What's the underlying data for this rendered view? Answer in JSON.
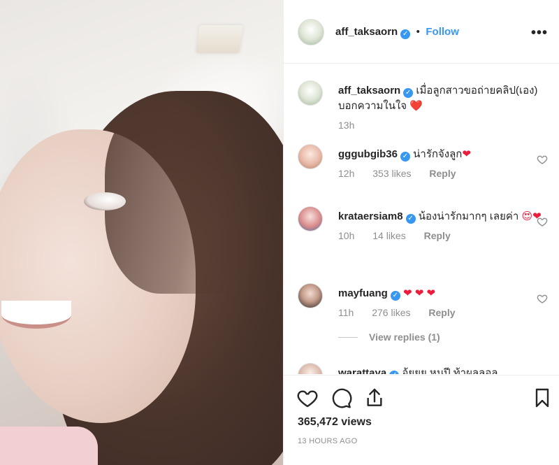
{
  "post_author": {
    "username": "aff_taksaorn",
    "follow_label": "Follow",
    "separator": "•"
  },
  "caption": {
    "username": "aff_taksaorn",
    "text": "เมื่อลูกสาวขอถ่ายคลิป(เอง) บอกความในใจ",
    "emoji": "❤️",
    "time": "13h"
  },
  "comments": [
    {
      "username": "gggubgib36",
      "text": "น่ารักจังลูก",
      "emoji": "❤",
      "time": "12h",
      "likes": "353 likes",
      "reply": "Reply"
    },
    {
      "username": "krataersiam8",
      "text": "น้องน่ารักมากๆ เลยค่า",
      "emoji": "😍❤",
      "time": "10h",
      "likes": "14 likes",
      "reply": "Reply"
    },
    {
      "username": "mayfuang",
      "text": "",
      "emoji": "❤ ❤ ❤",
      "time": "11h",
      "likes": "276 likes",
      "reply": "Reply"
    }
  ],
  "view_replies": "View replies (1)",
  "partial_comment": {
    "username": "warattaya",
    "text": "อ้ยยย หนูปี ท้าผลลอล"
  },
  "stats": {
    "views": "365,472 views",
    "posted": "13 HOURS AGO"
  },
  "icons": {
    "like": "heart-outline-icon",
    "comment": "speech-bubble-icon",
    "share": "share-upload-icon",
    "save": "bookmark-icon",
    "more": "ellipsis-icon",
    "verified": "verified-badge-icon"
  },
  "colors": {
    "accent": "#3897f0",
    "muted": "#8e8e8e",
    "heart": "#ed1c3a"
  }
}
